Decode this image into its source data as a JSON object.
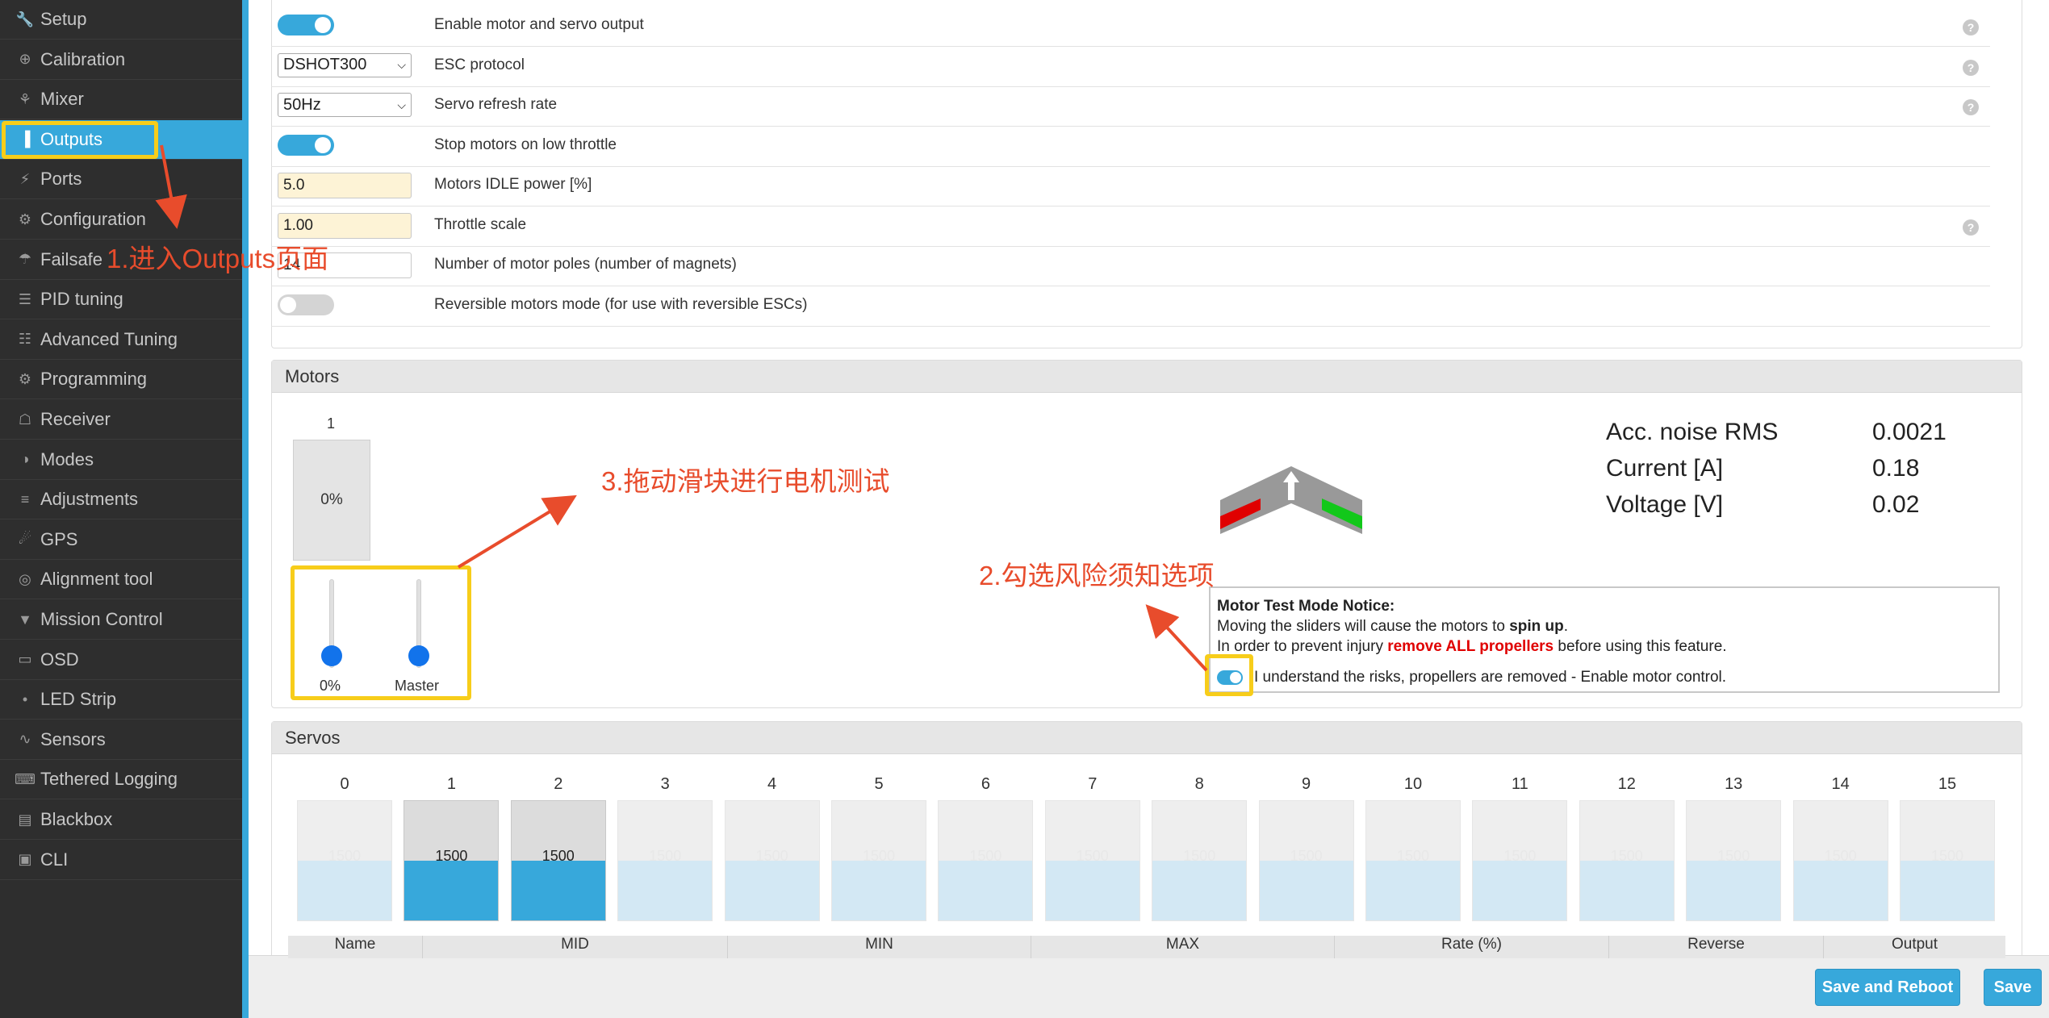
{
  "sidebar": {
    "items": [
      {
        "label": "Setup",
        "icon": "wrench-icon",
        "glyph": "🔧"
      },
      {
        "label": "Calibration",
        "icon": "crosshair-icon",
        "glyph": "⊕"
      },
      {
        "label": "Mixer",
        "icon": "mixer-icon",
        "glyph": "⚘"
      },
      {
        "label": "Outputs",
        "icon": "outputs-icon",
        "glyph": "▐"
      },
      {
        "label": "Ports",
        "icon": "plug-icon",
        "glyph": "⚡"
      },
      {
        "label": "Configuration",
        "icon": "gear-icon",
        "glyph": "⚙"
      },
      {
        "label": "Failsafe",
        "icon": "parachute-icon",
        "glyph": "☂"
      },
      {
        "label": "PID tuning",
        "icon": "sitemap-icon",
        "glyph": "☰"
      },
      {
        "label": "Advanced Tuning",
        "icon": "advanced-icon",
        "glyph": "☷"
      },
      {
        "label": "Programming",
        "icon": "gear-icon",
        "glyph": "⚙"
      },
      {
        "label": "Receiver",
        "icon": "robot-icon",
        "glyph": "☖"
      },
      {
        "label": "Modes",
        "icon": "toggles-icon",
        "glyph": "◑"
      },
      {
        "label": "Adjustments",
        "icon": "sliders-icon",
        "glyph": "≡"
      },
      {
        "label": "GPS",
        "icon": "satellite-icon",
        "glyph": "☄"
      },
      {
        "label": "Alignment tool",
        "icon": "compass-icon",
        "glyph": "◎"
      },
      {
        "label": "Mission Control",
        "icon": "map-pin-icon",
        "glyph": "▼"
      },
      {
        "label": "OSD",
        "icon": "osd-icon",
        "glyph": "▭"
      },
      {
        "label": "LED Strip",
        "icon": "bulb-icon",
        "glyph": "•"
      },
      {
        "label": "Sensors",
        "icon": "pulse-icon",
        "glyph": "∿"
      },
      {
        "label": "Tethered Logging",
        "icon": "keyboard-icon",
        "glyph": "⌨"
      },
      {
        "label": "Blackbox",
        "icon": "blackbox-icon",
        "glyph": "▤"
      },
      {
        "label": "CLI",
        "icon": "terminal-icon",
        "glyph": "▣"
      }
    ],
    "active_index": 3,
    "accent_color": "#37a8db"
  },
  "config": {
    "rows": [
      {
        "label": "Enable motor and servo output",
        "control": "toggle",
        "state": "on",
        "help": true
      },
      {
        "label": "ESC protocol",
        "control": "select",
        "value": "DSHOT300",
        "help": true
      },
      {
        "label": "Servo refresh rate",
        "control": "select",
        "value": "50Hz",
        "help": true
      },
      {
        "label": "Stop motors on low throttle",
        "control": "toggle",
        "state": "on",
        "help": false
      },
      {
        "label": "Motors IDLE power [%]",
        "control": "input",
        "value": "5.0",
        "help": false
      },
      {
        "label": "Throttle scale",
        "control": "input",
        "value": "1.00",
        "help": true
      },
      {
        "label": "Number of motor poles (number of magnets)",
        "control": "input-plain",
        "value": "14",
        "help": false
      },
      {
        "label": "Reversible motors mode (for use with reversible ESCs)",
        "control": "toggle",
        "state": "off",
        "help": false
      }
    ],
    "help_glyph": "?"
  },
  "motors": {
    "title": "Motors",
    "motor_index": "1",
    "motor_value": "0%",
    "slider_value_label": "0%",
    "master_label": "Master",
    "stats": [
      {
        "label": "Acc. noise RMS",
        "value": "0.0021"
      },
      {
        "label": "Current [A]",
        "value": "0.18"
      },
      {
        "label": "Voltage [V]",
        "value": "0.02"
      }
    ],
    "notice": {
      "title": "Motor Test Mode Notice:",
      "line1_pre": "Moving the sliders will cause the motors to ",
      "line1_bold": "spin up",
      "line1_post": ".",
      "line2_pre": "In order to prevent injury ",
      "line2_red": "remove ALL propellers",
      "line2_post": " before using this feature.",
      "toggle_label": "I understand the risks, propellers are removed - Enable motor control.",
      "toggle_state": "on"
    }
  },
  "servos": {
    "title": "Servos",
    "channels": [
      {
        "index": "0",
        "value": "1500",
        "active": false
      },
      {
        "index": "1",
        "value": "1500",
        "active": true
      },
      {
        "index": "2",
        "value": "1500",
        "active": true
      },
      {
        "index": "3",
        "value": "1500",
        "active": false
      },
      {
        "index": "4",
        "value": "1500",
        "active": false
      },
      {
        "index": "5",
        "value": "1500",
        "active": false
      },
      {
        "index": "6",
        "value": "1500",
        "active": false
      },
      {
        "index": "7",
        "value": "1500",
        "active": false
      },
      {
        "index": "8",
        "value": "1500",
        "active": false
      },
      {
        "index": "9",
        "value": "1500",
        "active": false
      },
      {
        "index": "10",
        "value": "1500",
        "active": false
      },
      {
        "index": "11",
        "value": "1500",
        "active": false
      },
      {
        "index": "12",
        "value": "1500",
        "active": false
      },
      {
        "index": "13",
        "value": "1500",
        "active": false
      },
      {
        "index": "14",
        "value": "1500",
        "active": false
      },
      {
        "index": "15",
        "value": "1500",
        "active": false
      }
    ],
    "table_headers": [
      "Name",
      "MID",
      "MIN",
      "MAX",
      "Rate (%)",
      "Reverse",
      "Output"
    ]
  },
  "footer": {
    "save_reboot_label": "Save and Reboot",
    "save_label": "Save"
  },
  "annotations": {
    "step1": "1.进入Outputs页面",
    "step2": "2.勾选风险须知选项",
    "step3": "3.拖动滑块进行电机测试",
    "annotation_color": "#e84c2c",
    "highlight_color": "#f7cd1a"
  }
}
